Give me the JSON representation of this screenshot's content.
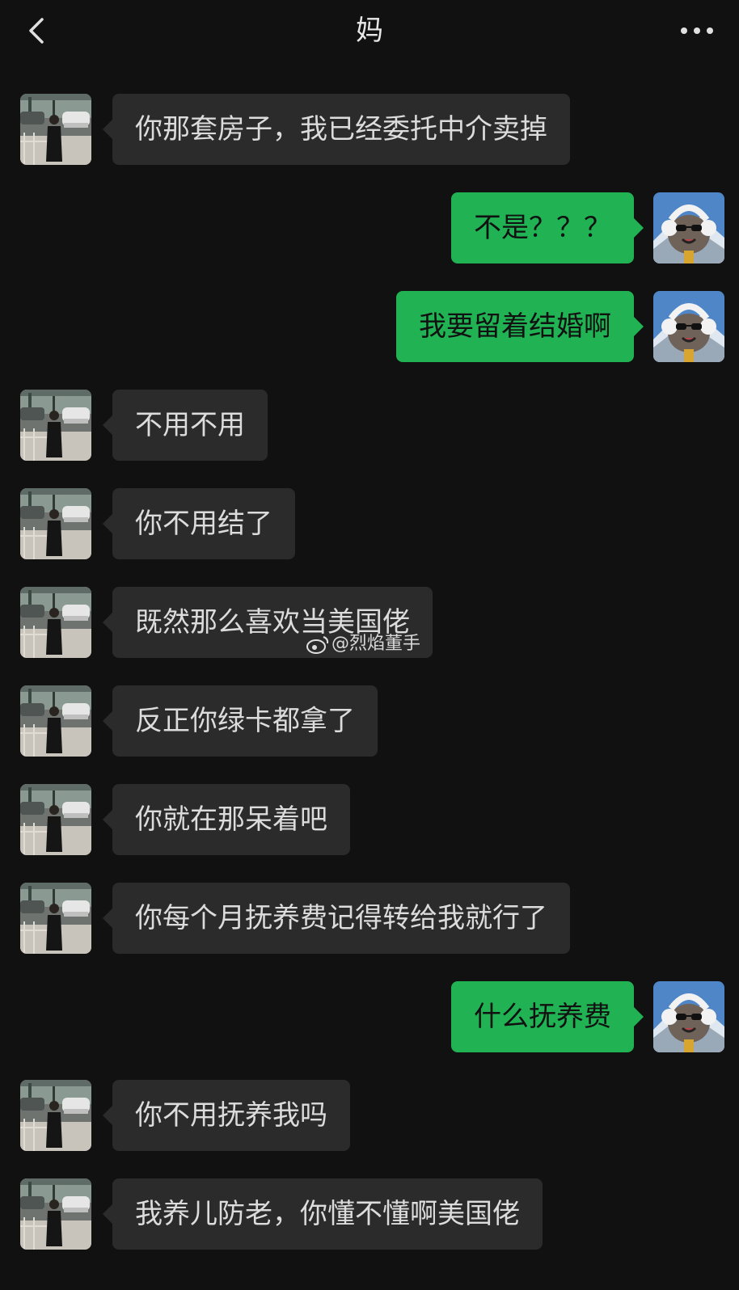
{
  "header": {
    "title": "妈",
    "back_icon": "chevron-left-icon",
    "more_icon": "more-dots-icon"
  },
  "colors": {
    "background": "#111111",
    "incoming_bubble": "#2b2b2b",
    "outgoing_bubble": "#20b253"
  },
  "messages": [
    {
      "side": "in",
      "text": "你那套房子，我已经委托中介卖掉"
    },
    {
      "side": "out",
      "text": "不是？？？"
    },
    {
      "side": "out",
      "text": "我要留着结婚啊"
    },
    {
      "side": "in",
      "text": "不用不用"
    },
    {
      "side": "in",
      "text": "你不用结了"
    },
    {
      "side": "in",
      "text": "既然那么喜欢当美国佬"
    },
    {
      "side": "in",
      "text": "反正你绿卡都拿了"
    },
    {
      "side": "in",
      "text": "你就在那呆着吧"
    },
    {
      "side": "in",
      "text": "你每个月抚养费记得转给我就行了"
    },
    {
      "side": "out",
      "text": "什么抚养费"
    },
    {
      "side": "in",
      "text": "你不用抚养我吗"
    },
    {
      "side": "in",
      "text": "我养儿防老，你懂不懂啊美国佬"
    }
  ],
  "watermark": {
    "icon": "weibo-icon",
    "text": "@烈焰董手"
  }
}
